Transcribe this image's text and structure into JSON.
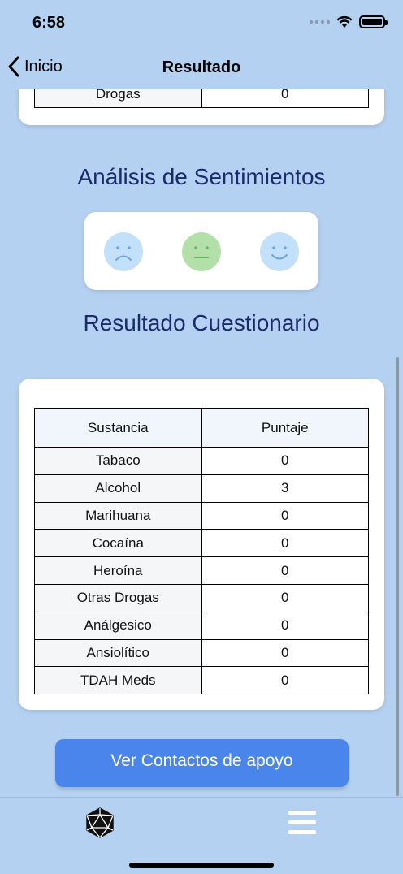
{
  "status": {
    "time": "6:58"
  },
  "nav": {
    "back_label": "Inicio",
    "title": "Resultado"
  },
  "top_table": {
    "rows": [
      {
        "sustancia": "Drogas",
        "puntaje": "0"
      }
    ]
  },
  "sentiment": {
    "title": "Análisis de Sentimientos",
    "faces": [
      {
        "name": "sad",
        "color": "#c3e0fa"
      },
      {
        "name": "neutral",
        "color": "#b3e0a9"
      },
      {
        "name": "happy",
        "color": "#c3e0fa"
      }
    ]
  },
  "questionnaire": {
    "title": "Resultado Cuestionario",
    "headers": {
      "sustancia": "Sustancia",
      "puntaje": "Puntaje"
    },
    "rows": [
      {
        "sustancia": "Tabaco",
        "puntaje": "0"
      },
      {
        "sustancia": "Alcohol",
        "puntaje": "3"
      },
      {
        "sustancia": "Marihuana",
        "puntaje": "0"
      },
      {
        "sustancia": "Cocaína",
        "puntaje": "0"
      },
      {
        "sustancia": "Heroína",
        "puntaje": "0"
      },
      {
        "sustancia": "Otras Drogas",
        "puntaje": "0"
      },
      {
        "sustancia": "Análgesico",
        "puntaje": "0"
      },
      {
        "sustancia": "Ansiolítico",
        "puntaje": "0"
      },
      {
        "sustancia": "TDAH Meds",
        "puntaje": "0"
      }
    ]
  },
  "cta": {
    "label": "Ver Contactos de apoyo"
  },
  "tab_bar": {
    "left_icon": "d20-dice-icon",
    "right_icon": "hamburger-menu-icon"
  },
  "colors": {
    "background": "#b5d1f1",
    "title": "#1a2a6b",
    "button": "#4a85ec"
  }
}
